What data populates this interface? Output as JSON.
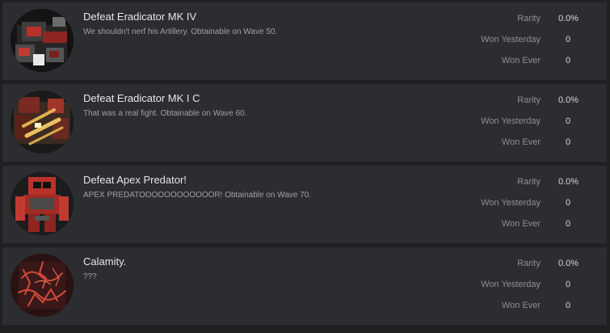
{
  "badges": [
    {
      "title": "Defeat Eradicator MK IV",
      "description": "We shouldn't nerf his Artillery. Obtainable on Wave 50.",
      "icon": "eradicator-mk4-badge-icon",
      "stats": [
        {
          "label": "Rarity",
          "value": "0.0%"
        },
        {
          "label": "Won Yesterday",
          "value": "0"
        },
        {
          "label": "Won Ever",
          "value": "0"
        }
      ]
    },
    {
      "title": "Defeat Eradicator MK I C",
      "description": "That was a real fight. Obtainable on Wave 60.",
      "icon": "eradicator-mk1c-badge-icon",
      "stats": [
        {
          "label": "Rarity",
          "value": "0.0%"
        },
        {
          "label": "Won Yesterday",
          "value": "0"
        },
        {
          "label": "Won Ever",
          "value": "0"
        }
      ]
    },
    {
      "title": "Defeat Apex Predator!",
      "description": "APEX PREDATOOOOOOOOOOOOR! Obtainable on Wave 70.",
      "icon": "apex-predator-badge-icon",
      "stats": [
        {
          "label": "Rarity",
          "value": "0.0%"
        },
        {
          "label": "Won Yesterday",
          "value": "0"
        },
        {
          "label": "Won Ever",
          "value": "0"
        }
      ]
    },
    {
      "title": "Calamity.",
      "description": "???",
      "icon": "calamity-badge-icon",
      "stats": [
        {
          "label": "Rarity",
          "value": "0.0%"
        },
        {
          "label": "Won Yesterday",
          "value": "0"
        },
        {
          "label": "Won Ever",
          "value": "0"
        }
      ]
    }
  ],
  "colors": {
    "page_background": "#1f2022",
    "card_background": "#2c2d30",
    "title_text": "#e7e7e8",
    "description_text": "#9fa0a3",
    "stat_label_text": "#8e8f92",
    "stat_value_text": "#d7d7d9",
    "badge_red": "#b8322a"
  }
}
